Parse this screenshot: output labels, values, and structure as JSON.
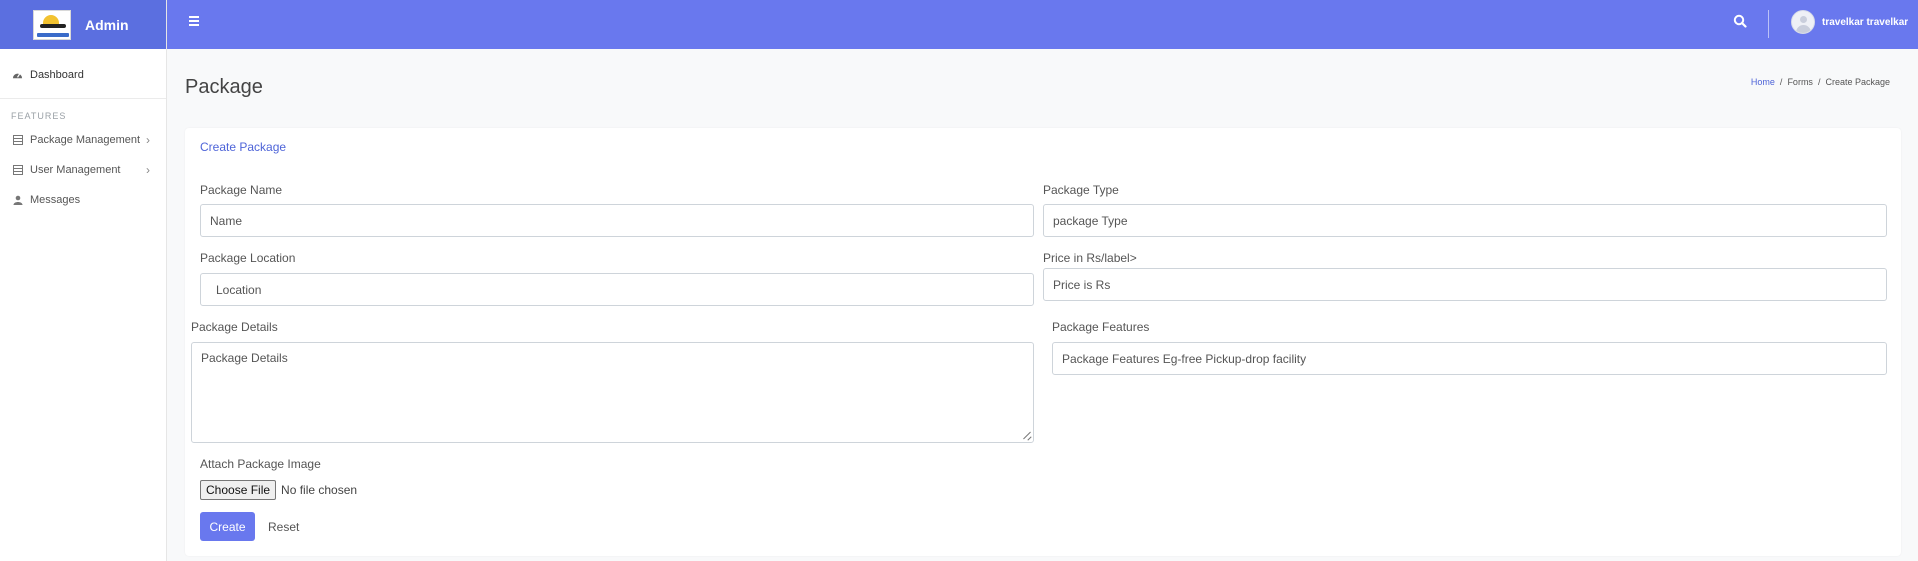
{
  "brand": {
    "title": "Admin",
    "logo_icon": "travel-logo"
  },
  "sidebar": {
    "dashboard": {
      "label": "Dashboard",
      "icon": "gauge-icon"
    },
    "section_label": "FEATURES",
    "items": [
      {
        "label": "Package Management",
        "icon": "table-icon",
        "has_submenu": true
      },
      {
        "label": "User Management",
        "icon": "table-icon",
        "has_submenu": true
      },
      {
        "label": "Messages",
        "icon": "user-icon",
        "has_submenu": false
      }
    ]
  },
  "topbar": {
    "menu_icon": "hamburger-icon",
    "search_icon": "search-icon",
    "user_name": "travelkar travelkar"
  },
  "page": {
    "title": "Package",
    "breadcrumb": [
      "Home",
      "Forms",
      "Create Package"
    ]
  },
  "form": {
    "title": "Create Package",
    "package_name": {
      "label": "Package Name",
      "placeholder": "Name"
    },
    "package_type": {
      "label": "Package Type",
      "placeholder": "package Type"
    },
    "package_location": {
      "label": "Package Location",
      "placeholder": "Location"
    },
    "price": {
      "label": "Price in Rs/label>",
      "placeholder": "Price is Rs"
    },
    "package_details": {
      "label": "Package Details",
      "placeholder": "Package Details"
    },
    "package_features": {
      "label": "Package Features",
      "placeholder": "Package Features Eg-free Pickup-drop facility"
    },
    "image": {
      "label": "Attach Package Image",
      "button": "Choose File",
      "status": "No file chosen"
    },
    "create_label": "Create",
    "reset_label": "Reset"
  },
  "colors": {
    "accent": "#6978ee",
    "link": "#4e64d8",
    "brand_bg": "#5b6fe0"
  }
}
